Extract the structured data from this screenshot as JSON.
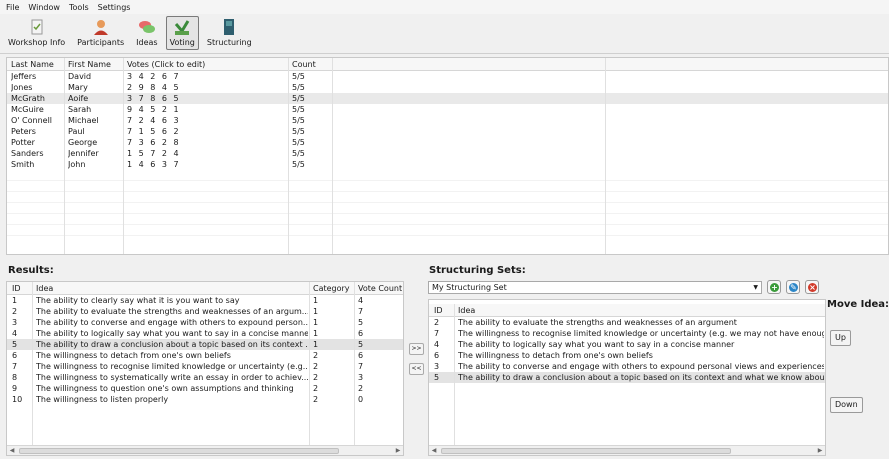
{
  "menu": [
    "File",
    "Window",
    "Tools",
    "Settings"
  ],
  "toolbar": [
    {
      "label": "Workshop Info",
      "icon": "checklist-icon"
    },
    {
      "label": "Participants",
      "icon": "person-icon"
    },
    {
      "label": "Ideas",
      "icon": "chat-bubbles-icon"
    },
    {
      "label": "Voting",
      "icon": "vote-icon"
    },
    {
      "label": "Structuring",
      "icon": "book-icon"
    }
  ],
  "participants": {
    "headers": [
      "Last Name",
      "First Name",
      "Votes (Click to edit)",
      "Count"
    ],
    "rows": [
      [
        "Jeffers",
        "David",
        "3 4 2 6 7",
        "5/5"
      ],
      [
        "Jones",
        "Mary",
        "2 9 8 4 5",
        "5/5"
      ],
      [
        "McGrath",
        "Aoife",
        "3 7 8 6 5",
        "5/5"
      ],
      [
        "McGuire",
        "Sarah",
        "9 4 5 2 1",
        "5/5"
      ],
      [
        "O' Connell",
        "Michael",
        "7 2 4 6 3",
        "5/5"
      ],
      [
        "Peters",
        "Paul",
        "7 1 5 6 2",
        "5/5"
      ],
      [
        "Potter",
        "George",
        "7 3 6 2 8",
        "5/5"
      ],
      [
        "Sanders",
        "Jennifer",
        "1 5 7 2 4",
        "5/5"
      ],
      [
        "Smith",
        "John",
        "1 4 6 3 7",
        "5/5"
      ]
    ]
  },
  "results": {
    "title": "Results:",
    "headers": [
      "ID",
      "Idea",
      "Category",
      "Vote Count"
    ],
    "rows": [
      [
        "1",
        "The ability to clearly say what it is you want to say",
        "1",
        "4"
      ],
      [
        "2",
        "The ability to evaluate the strengths and weaknesses of an argum...",
        "1",
        "7"
      ],
      [
        "3",
        "The ability to converse and engage with others to expound person...",
        "1",
        "5"
      ],
      [
        "4",
        "The ability to logically say what you want to say in a concise manner",
        "1",
        "6"
      ],
      [
        "5",
        "The ability to draw a conclusion about a topic based on its context ...",
        "1",
        "5"
      ],
      [
        "6",
        "The willingness to detach from one's own beliefs",
        "2",
        "6"
      ],
      [
        "7",
        "The willingness to recognise limited knowledge or uncertainty (e.g...",
        "2",
        "7"
      ],
      [
        "8",
        "The willingness to systematically write an essay in order to achiev...",
        "2",
        "3"
      ],
      [
        "9",
        "The willingness to question one's own assumptions and thinking",
        "2",
        "2"
      ],
      [
        "10",
        "The willingness to listen properly",
        "2",
        "0"
      ]
    ]
  },
  "move_buttons": {
    "right": ">>",
    "left": "<<"
  },
  "structuring": {
    "title": "Structuring Sets:",
    "selected_set": "My Structuring Set",
    "headers": [
      "ID",
      "Idea"
    ],
    "rows": [
      [
        "2",
        "The ability to evaluate the strengths and weaknesses of an argument"
      ],
      [
        "7",
        "The willingness to recognise limited knowledge or uncertainty (e.g. we may not have enough k"
      ],
      [
        "4",
        "The ability to logically say what you want to say in a concise manner"
      ],
      [
        "6",
        "The willingness to detach from one's own beliefs"
      ],
      [
        "3",
        "The ability to converse and engage with others to expound personal views and experiences"
      ],
      [
        "5",
        "The ability to draw a conclusion about a topic based on its context and what we know about th"
      ]
    ],
    "add_icon": "plus-icon",
    "edit_icon": "edit-icon",
    "delete_icon": "delete-icon",
    "colors": {
      "add": "#3a9b3a",
      "edit": "#2b86c7",
      "delete": "#d23a2a"
    }
  },
  "move_idea": {
    "title": "Move Idea:",
    "up": "Up",
    "down": "Down"
  }
}
